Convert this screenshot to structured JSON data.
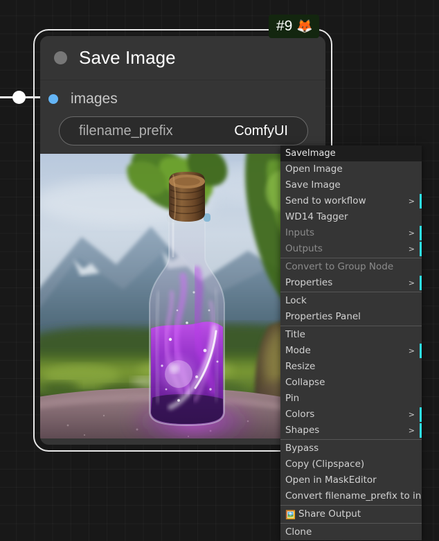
{
  "app": {
    "name": "ComfyUI",
    "canvas_background": "#181818",
    "grid_color": "#242424"
  },
  "node": {
    "title": "Save Image",
    "badge": {
      "number": "#9",
      "emoji": "🦊",
      "background": "#13260f"
    },
    "collapse_toggle_icon": "circle-icon",
    "inputs": [
      {
        "name": "images",
        "label": "images",
        "dot_color": "#64b5f6"
      }
    ],
    "widgets": [
      {
        "name": "filename_prefix",
        "label": "filename_prefix",
        "value": "ComfyUI",
        "type": "text"
      }
    ],
    "preview": {
      "alt": "Generated image: glowing purple potion bottle with cork on a rock, mountains and green valley behind",
      "visible": true
    },
    "selected": true,
    "selection_outline_color": "#e8e8e8"
  },
  "link": {
    "color": "#f4f4f4",
    "reroute_dot_color": "#ffffff"
  },
  "context_menu": {
    "title": "SaveImage",
    "submenu_arrow": ">",
    "submenu_bar_color": "#2ee0e8",
    "groups": [
      {
        "items": [
          {
            "label": "Open Image",
            "submenu": false,
            "disabled": false
          },
          {
            "label": "Save Image",
            "submenu": false,
            "disabled": false
          },
          {
            "label": "Send to workflow",
            "submenu": true,
            "disabled": false
          },
          {
            "label": "WD14 Tagger",
            "submenu": false,
            "disabled": false
          },
          {
            "label": "Inputs",
            "submenu": true,
            "disabled": true
          },
          {
            "label": "Outputs",
            "submenu": true,
            "disabled": true
          }
        ]
      },
      {
        "items": [
          {
            "label": "Convert to Group Node",
            "submenu": false,
            "disabled": true
          },
          {
            "label": "Properties",
            "submenu": true,
            "disabled": false
          }
        ]
      },
      {
        "items": [
          {
            "label": "Lock",
            "submenu": false,
            "disabled": false
          },
          {
            "label": "Properties Panel",
            "submenu": false,
            "disabled": false
          }
        ]
      },
      {
        "items": [
          {
            "label": "Title",
            "submenu": false,
            "disabled": false
          },
          {
            "label": "Mode",
            "submenu": true,
            "disabled": false
          },
          {
            "label": "Resize",
            "submenu": false,
            "disabled": false
          },
          {
            "label": "Collapse",
            "submenu": false,
            "disabled": false
          },
          {
            "label": "Pin",
            "submenu": false,
            "disabled": false
          },
          {
            "label": "Colors",
            "submenu": true,
            "disabled": false
          },
          {
            "label": "Shapes",
            "submenu": true,
            "disabled": false
          }
        ]
      },
      {
        "items": [
          {
            "label": "Bypass",
            "submenu": false,
            "disabled": false
          },
          {
            "label": "Copy (Clipspace)",
            "submenu": false,
            "disabled": false
          },
          {
            "label": "Open in MaskEditor",
            "submenu": false,
            "disabled": false
          },
          {
            "label": "Convert filename_prefix to input",
            "submenu": false,
            "disabled": false
          }
        ]
      },
      {
        "items": [
          {
            "label": "Share Output",
            "submenu": false,
            "disabled": false,
            "icon": "🖼️"
          }
        ]
      },
      {
        "items": [
          {
            "label": "Clone",
            "submenu": false,
            "disabled": false
          }
        ]
      }
    ]
  }
}
